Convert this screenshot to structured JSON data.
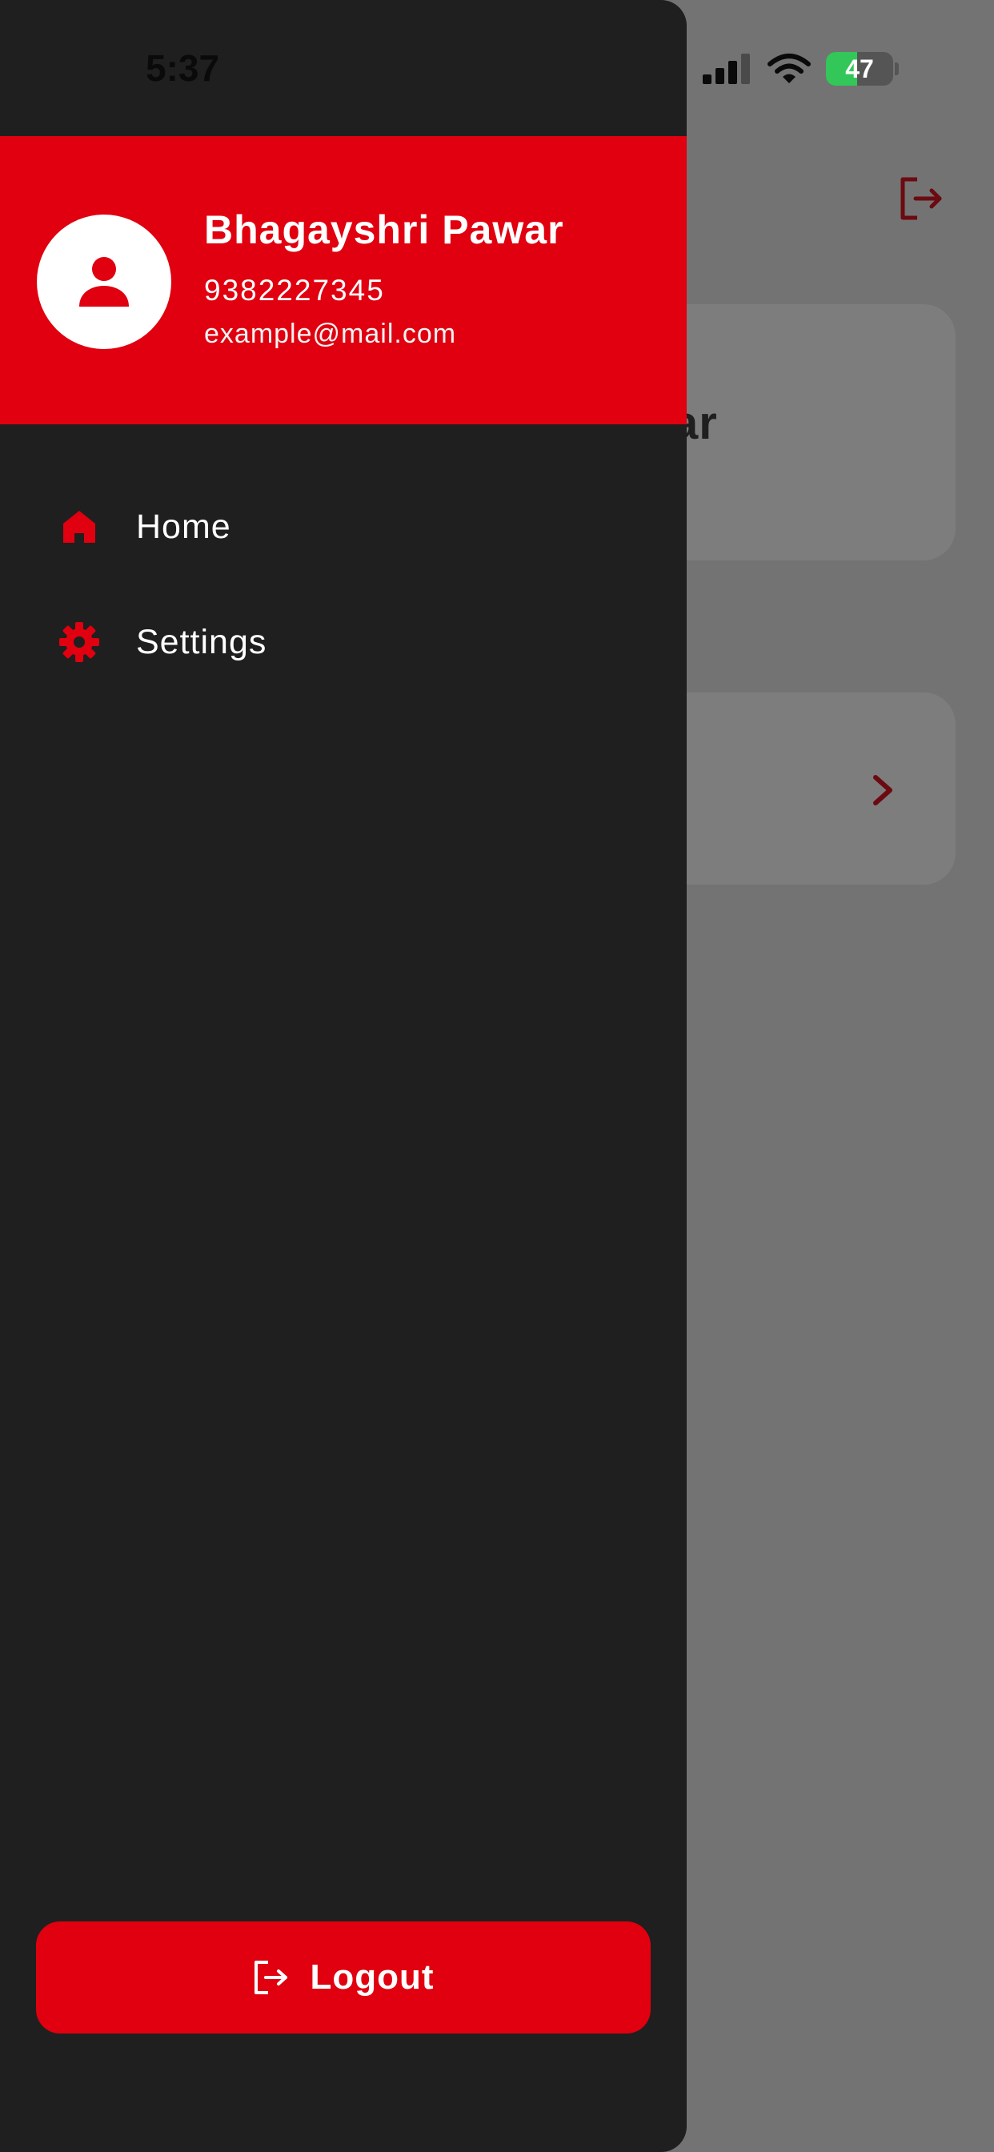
{
  "status_bar": {
    "time": "5:37",
    "battery_level": "47",
    "battery_fraction": 0.47,
    "icons": [
      "signal-icon",
      "wifi-icon",
      "battery-icon"
    ]
  },
  "background": {
    "card_1_text_fragment": "ar",
    "icons": [
      "logout-icon",
      "chevron-right-icon"
    ]
  },
  "drawer": {
    "header": {
      "name": "Bhagayshri Pawar",
      "phone": "9382227345",
      "email": "example@mail.com",
      "avatar_icon": "person-icon"
    },
    "nav_items": [
      {
        "label": "Home",
        "icon": "home-icon"
      },
      {
        "label": "Settings",
        "icon": "gear-icon"
      }
    ],
    "logout": {
      "label": "Logout",
      "icon": "logout-icon"
    }
  },
  "colors": {
    "accent": "#e0000f",
    "drawer_bg": "#1f1f1f",
    "scrim": "#737373",
    "battery_green": "#33c759"
  }
}
